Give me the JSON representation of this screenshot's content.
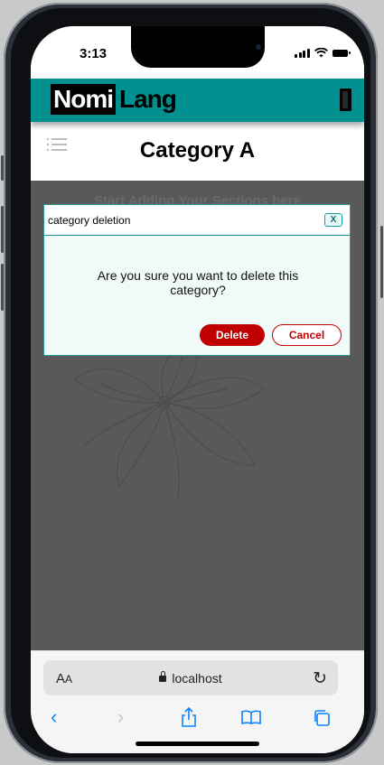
{
  "status_bar": {
    "time": "3:13"
  },
  "app": {
    "logo_part1": "Nomi",
    "logo_part2": "Lang",
    "page_title": "Category A"
  },
  "content": {
    "hint": "Start Adding Your Sections here"
  },
  "modal": {
    "title": "category deletion",
    "close_label": "X",
    "message": "Are you sure you want to delete this category?",
    "delete_label": "Delete",
    "cancel_label": "Cancel"
  },
  "browser": {
    "text_size_label": "A",
    "text_size_label_small": "A",
    "url": "localhost"
  },
  "colors": {
    "accent": "#009090",
    "danger": "#c00000",
    "overlay": "#595959"
  }
}
